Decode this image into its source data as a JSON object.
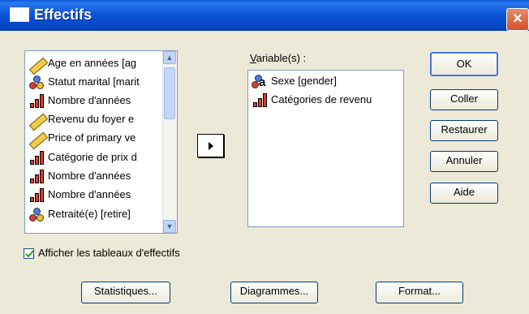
{
  "window": {
    "title": "Effectifs",
    "close_glyph": "×"
  },
  "source_list": {
    "items": [
      {
        "label": "Age en années [ag",
        "icon": "ruler-icon"
      },
      {
        "label": "Statut marital [marit",
        "icon": "nominal-icon"
      },
      {
        "label": "Nombre d'années",
        "icon": "ordinal-icon"
      },
      {
        "label": "Revenu du foyer e",
        "icon": "ruler-icon"
      },
      {
        "label": "Price of primary ve",
        "icon": "ruler-icon"
      },
      {
        "label": "Catégorie de prix d",
        "icon": "ordinal-icon"
      },
      {
        "label": "Nombre d'années",
        "icon": "ordinal-icon"
      },
      {
        "label": "Nombre d'années",
        "icon": "ordinal-icon"
      },
      {
        "label": "Retraité(e) [retire]",
        "icon": "nominal-icon"
      }
    ]
  },
  "target": {
    "label": "Variable(s) :",
    "items": [
      {
        "label": "Sexe [gender]",
        "icon": "string-nominal-icon"
      },
      {
        "label": "Catégories de revenu",
        "icon": "ordinal-icon"
      }
    ]
  },
  "buttons": {
    "ok": "OK",
    "paste": "Coller",
    "reset": "Restaurer",
    "cancel": "Annuler",
    "help": "Aide",
    "statistics": "Statistiques...",
    "charts": "Diagrammes...",
    "format": "Format..."
  },
  "checkbox": {
    "label": "Afficher les tableaux d'effectifs",
    "checked": true
  }
}
